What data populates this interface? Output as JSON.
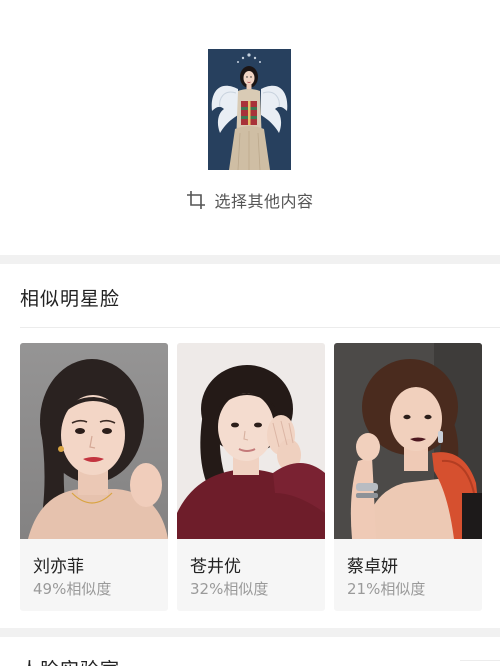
{
  "query": {
    "crop_label": "选择其他内容"
  },
  "similar": {
    "title": "相似明星脸",
    "cards": [
      {
        "name": "刘亦菲",
        "similarity": "49%相似度"
      },
      {
        "name": "苍井优",
        "similarity": "32%相似度"
      },
      {
        "name": "蔡卓妍",
        "similarity": "21%相似度"
      }
    ]
  },
  "next_section": {
    "title": "人脸实验室"
  },
  "colors": {
    "background": "#ffffff",
    "band": "#f1f1f1",
    "card_bg": "#f6f6f6",
    "primary_text": "#222222",
    "secondary_text": "#9a9a9a"
  }
}
